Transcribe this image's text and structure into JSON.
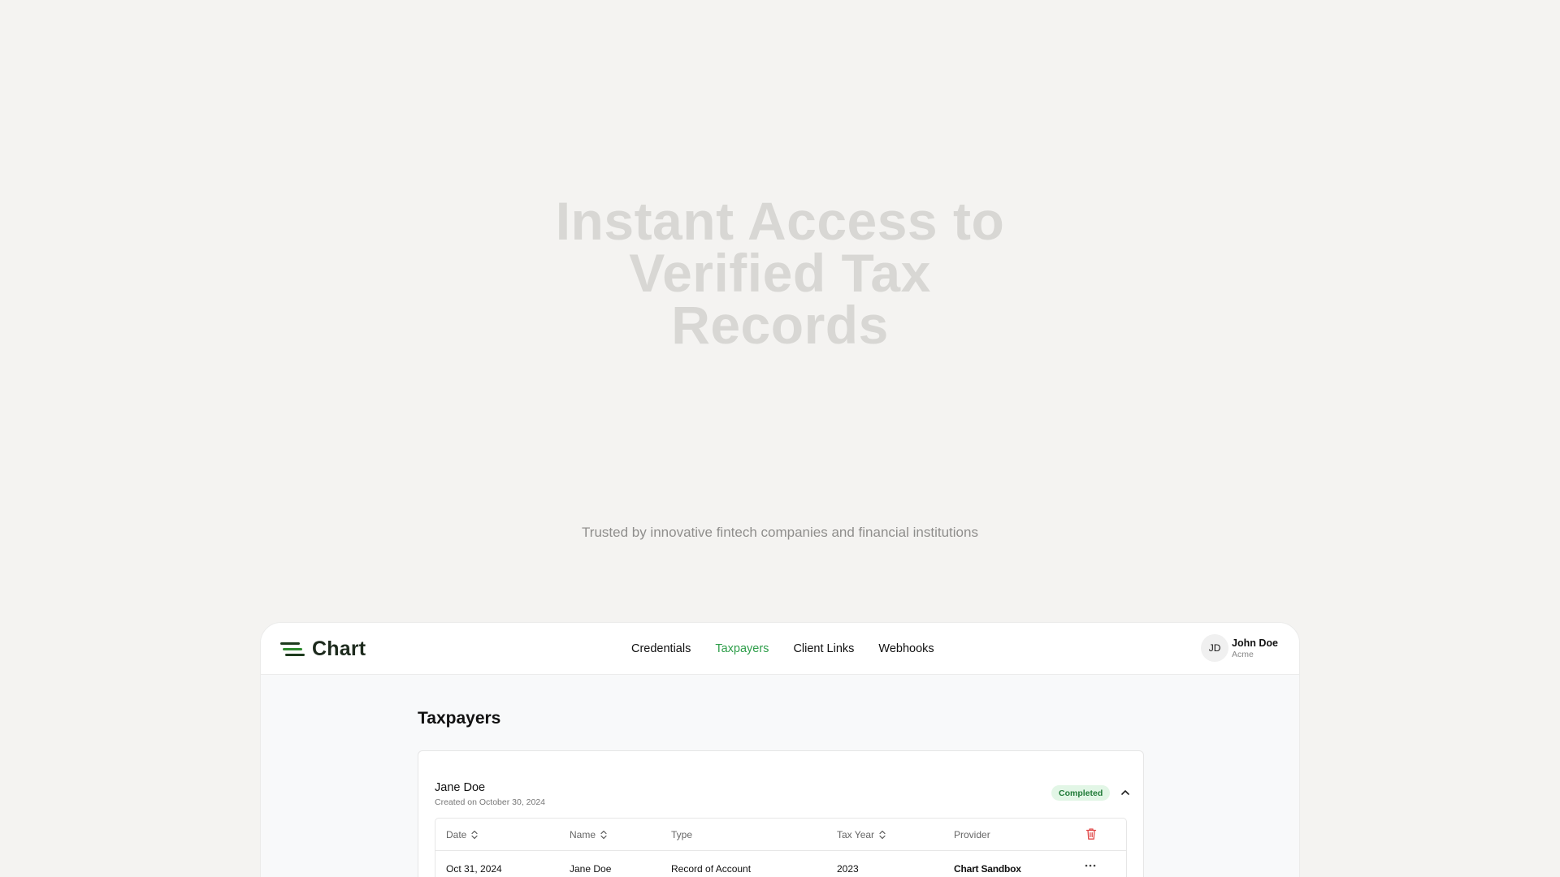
{
  "hero": {
    "title": "Instant Access to Verified Tax Records",
    "subtitle": "Trusted by innovative fintech companies and financial institutions"
  },
  "app": {
    "logo_text": "Chart",
    "nav": [
      {
        "label": "Credentials",
        "active": false
      },
      {
        "label": "Taxpayers",
        "active": true
      },
      {
        "label": "Client Links",
        "active": false
      },
      {
        "label": "Webhooks",
        "active": false
      }
    ],
    "user": {
      "initials": "JD",
      "name": "John Doe",
      "org": "Acme"
    },
    "page_title": "Taxpayers",
    "taxpayer": {
      "name": "Jane Doe",
      "created": "Created on October 30, 2024",
      "status": "Completed",
      "columns": [
        "Date",
        "Name",
        "Type",
        "Tax Year",
        "Provider"
      ],
      "rows": [
        {
          "date": "Oct 31, 2024",
          "name": "Jane Doe",
          "type": "Record of Account",
          "tax_year": "2023",
          "provider": "Chart Sandbox"
        }
      ]
    }
  },
  "colors": {
    "background": "#f4f3f1",
    "accent": "#2e9e4a",
    "status_bg": "#e2f6e6",
    "status_text": "#1f7a37",
    "danger": "#e04848"
  },
  "icons": [
    "logo-icon",
    "sort-icon",
    "chevron-up-icon",
    "trash-icon",
    "more-icon"
  ]
}
